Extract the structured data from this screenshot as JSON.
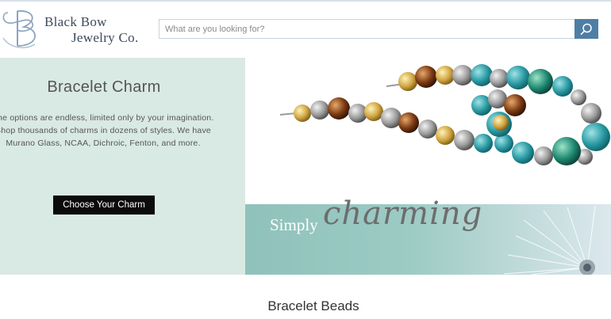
{
  "header": {
    "logo": {
      "line1": "Black Bow",
      "line2": "Jewelry Co."
    },
    "search": {
      "placeholder": "What are you looking for?",
      "value": "",
      "button_icon": "search-icon"
    }
  },
  "hero": {
    "title": "Bracelet Charm",
    "description": "The options are endless, limited only by your imagination. Shop thousands of  charms in dozens of styles. We have Murano Glass, NCAA,  Dichroic, Fenton, and more.",
    "cta_label": "Choose Your Charm",
    "banner": {
      "word1": "Simply",
      "word2": "charming"
    }
  },
  "sections": {
    "next_title": "Bracelet Beads"
  },
  "colors": {
    "accent": "#4f7ea5",
    "hero_bg": "#d9e9e3",
    "cta_bg": "#0b0b0b",
    "banner_teal": "#8fc2bb"
  }
}
